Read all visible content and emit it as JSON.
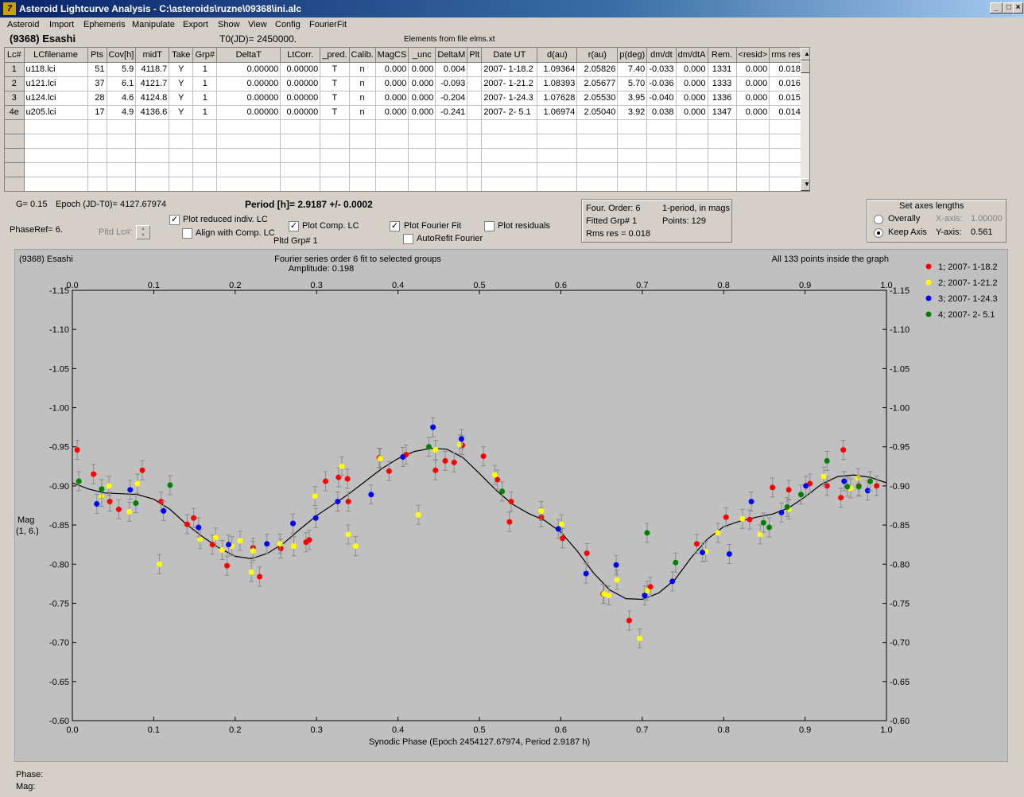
{
  "window": {
    "title": "Asteroid Lightcurve Analysis - C:\\asteroids\\ruzne\\09368\\ini.alc",
    "min_label": "_",
    "max_label": "□",
    "close_label": "×"
  },
  "menu": [
    "Asteroid",
    "Import",
    "Ephemeris",
    "Manipulate",
    "Export",
    "Show",
    "View",
    "Config",
    "FourierFit"
  ],
  "header": {
    "asteroid": "(9368) Esashi",
    "t0": "T0(JD)= 2450000.",
    "elements": "Elements from file elms.xt"
  },
  "grid": {
    "columns": [
      "Lc#",
      "LCfilename",
      "Pts",
      "Cov[h]",
      "midT",
      "Take",
      "Grp#",
      "DeltaT",
      "LtCorr.",
      "_pred.",
      "Calib.",
      "MagCS",
      "_unc",
      "DeltaM",
      "Plt",
      "Date UT",
      "d(au)",
      "r(au)",
      "p(deg)",
      "dm/dt",
      "dm/dtA",
      "Rem.",
      "<resid>",
      "rms res"
    ],
    "rows": [
      [
        "1",
        "u118.lci",
        "51",
        "5.9",
        "4118.7",
        "Y",
        "1",
        "0.00000",
        "0.00000",
        "T",
        "n",
        "0.000",
        "0.000",
        "0.004",
        "",
        "2007- 1-18.2",
        "1.09364",
        "2.05826",
        "7.40",
        "-0.033",
        "0.000",
        "1331",
        "0.000",
        "0.018"
      ],
      [
        "2",
        "u121.lci",
        "37",
        "6.1",
        "4121.7",
        "Y",
        "1",
        "0.00000",
        "0.00000",
        "T",
        "n",
        "0.000",
        "0.000",
        "-0.093",
        "",
        "2007- 1-21.2",
        "1.08393",
        "2.05677",
        "5.70",
        "-0.036",
        "0.000",
        "1333",
        "0.000",
        "0.016"
      ],
      [
        "3",
        "u124.lci",
        "28",
        "4.6",
        "4124.8",
        "Y",
        "1",
        "0.00000",
        "0.00000",
        "T",
        "n",
        "0.000",
        "0.000",
        "-0.204",
        "",
        "2007- 1-24.3",
        "1.07628",
        "2.05530",
        "3.95",
        "-0.040",
        "0.000",
        "1336",
        "0.000",
        "0.015"
      ],
      [
        "4e",
        "u205.lci",
        "17",
        "4.9",
        "4136.6",
        "Y",
        "1",
        "0.00000",
        "0.00000",
        "T",
        "n",
        "0.000",
        "0.000",
        "-0.241",
        "",
        "2007- 2- 5.1",
        "1.06974",
        "2.05040",
        "3.92",
        "0.038",
        "0.000",
        "1347",
        "0.000",
        "0.014"
      ]
    ],
    "empty_rows": 6,
    "scroll_up": "▲",
    "scroll_down": "▼"
  },
  "controls": {
    "g_label": "G= 0.15",
    "epoch_label": "Epoch (JD-T0)= 4127.67974",
    "period_label": "Period [h]= 2.9187 +/- 0.0002",
    "phaseref_label": "PhaseRef= 6.",
    "pltd_lc_label": "Pltd Lc#:",
    "pltd_grp_label": "Pltd Grp#  1",
    "plot_reduced": {
      "label": "Plot reduced indiv. LC",
      "checked": true
    },
    "align_comp": {
      "label": "Align with Comp. LC",
      "checked": false
    },
    "plot_comp": {
      "label": "Plot Comp. LC",
      "checked": true
    },
    "plot_fourier": {
      "label": "Plot Fourier Fit",
      "checked": true
    },
    "autorefit": {
      "label": "AutoRefit Fourier",
      "checked": false
    },
    "plot_residuals": {
      "label": "Plot residuals",
      "checked": false
    },
    "check_mark": "✓"
  },
  "fourier_box": {
    "order": "Four. Order:  6",
    "mode": "1-period, in mags",
    "fitted": "Fitted Grp# 1",
    "points": "Points: 129",
    "rms": "Rms res     = 0.018"
  },
  "axes_box": {
    "title": "Set axes lengths",
    "overally": "Overally",
    "keep_axis": "Keep Axis",
    "x_axis_label": "X-axis:",
    "x_axis_value": "1.00000",
    "y_axis_label": "Y-axis:",
    "y_axis_value": "0.561"
  },
  "chart_data": {
    "type": "scatter",
    "top_left_text": "(9368) Esashi",
    "title": "Fourier series order 6 fit to selected groups",
    "subtitle": "Amplitude: 0.198",
    "top_right_text": "All 133 points inside the graph",
    "xlabel": "Synodic Phase (Epoch 2454127.67974, Period 2.9187 h)",
    "ylabel": "Mag",
    "ylabel2": "(1, 6.)",
    "xlim": [
      0,
      1
    ],
    "ylim": [
      -1.15,
      -0.6
    ],
    "y_inverted": true,
    "x_ticks": [
      "0.0",
      "0.1",
      "0.2",
      "0.3",
      "0.4",
      "0.5",
      "0.6",
      "0.7",
      "0.8",
      "0.9",
      "1.0"
    ],
    "y_ticks": [
      "-1.15",
      "-1.10",
      "-1.05",
      "-1.00",
      "-0.95",
      "-0.90",
      "-0.85",
      "-0.80",
      "-0.75",
      "-0.70",
      "-0.65",
      "-0.60"
    ],
    "series": [
      {
        "name": "1; 2007- 1-18.2",
        "color": "#ff0000",
        "points": [
          [
            0.006,
            -0.946
          ],
          [
            0.026,
            -0.915
          ],
          [
            0.046,
            -0.88
          ],
          [
            0.057,
            -0.87
          ],
          [
            0.086,
            -0.92
          ],
          [
            0.109,
            -0.88
          ],
          [
            0.141,
            -0.851
          ],
          [
            0.149,
            -0.859
          ],
          [
            0.172,
            -0.825
          ],
          [
            0.19,
            -0.798
          ],
          [
            0.222,
            -0.821
          ],
          [
            0.23,
            -0.784
          ],
          [
            0.256,
            -0.82
          ],
          [
            0.287,
            -0.828
          ],
          [
            0.291,
            -0.831
          ],
          [
            0.311,
            -0.906
          ],
          [
            0.327,
            -0.911
          ],
          [
            0.338,
            -0.909
          ],
          [
            0.339,
            -0.88
          ],
          [
            0.377,
            -0.936
          ],
          [
            0.389,
            -0.919
          ],
          [
            0.41,
            -0.94
          ],
          [
            0.446,
            -0.92
          ],
          [
            0.458,
            -0.932
          ],
          [
            0.469,
            -0.93
          ],
          [
            0.479,
            -0.952
          ],
          [
            0.505,
            -0.938
          ],
          [
            0.522,
            -0.908
          ],
          [
            0.537,
            -0.854
          ],
          [
            0.539,
            -0.88
          ],
          [
            0.576,
            -0.86
          ],
          [
            0.602,
            -0.833
          ],
          [
            0.632,
            -0.814
          ],
          [
            0.652,
            -0.762
          ],
          [
            0.684,
            -0.728
          ],
          [
            0.71,
            -0.771
          ],
          [
            0.767,
            -0.826
          ],
          [
            0.803,
            -0.86
          ],
          [
            0.832,
            -0.857
          ],
          [
            0.86,
            -0.898
          ],
          [
            0.88,
            -0.895
          ],
          [
            0.906,
            -0.903
          ],
          [
            0.927,
            -0.9
          ],
          [
            0.944,
            -0.885
          ],
          [
            0.947,
            -0.946
          ],
          [
            0.966,
            -0.9
          ],
          [
            0.988,
            -0.9
          ]
        ]
      },
      {
        "name": "2; 2007- 1-21.2",
        "color": "#ffff00",
        "points": [
          [
            0.036,
            -0.886
          ],
          [
            0.045,
            -0.9
          ],
          [
            0.07,
            -0.867
          ],
          [
            0.08,
            -0.903
          ],
          [
            0.107,
            -0.8
          ],
          [
            0.157,
            -0.832
          ],
          [
            0.176,
            -0.834
          ],
          [
            0.184,
            -0.818
          ],
          [
            0.196,
            -0.823
          ],
          [
            0.206,
            -0.83
          ],
          [
            0.22,
            -0.79
          ],
          [
            0.222,
            -0.817
          ],
          [
            0.255,
            -0.826
          ],
          [
            0.272,
            -0.823
          ],
          [
            0.298,
            -0.887
          ],
          [
            0.331,
            -0.925
          ],
          [
            0.339,
            -0.838
          ],
          [
            0.348,
            -0.823
          ],
          [
            0.378,
            -0.935
          ],
          [
            0.425,
            -0.863
          ],
          [
            0.446,
            -0.946
          ],
          [
            0.476,
            -0.953
          ],
          [
            0.519,
            -0.914
          ],
          [
            0.576,
            -0.868
          ],
          [
            0.601,
            -0.851
          ],
          [
            0.653,
            -0.762
          ],
          [
            0.659,
            -0.76
          ],
          [
            0.669,
            -0.78
          ],
          [
            0.697,
            -0.705
          ],
          [
            0.706,
            -0.766
          ],
          [
            0.778,
            -0.816
          ],
          [
            0.793,
            -0.84
          ],
          [
            0.823,
            -0.858
          ],
          [
            0.845,
            -0.838
          ],
          [
            0.88,
            -0.87
          ],
          [
            0.923,
            -0.912
          ],
          [
            0.956,
            -0.897
          ],
          [
            0.965,
            -0.91
          ]
        ]
      },
      {
        "name": "3; 2007- 1-24.3",
        "color": "#0000ff",
        "points": [
          [
            0.03,
            -0.877
          ],
          [
            0.071,
            -0.895
          ],
          [
            0.112,
            -0.868
          ],
          [
            0.155,
            -0.847
          ],
          [
            0.192,
            -0.825
          ],
          [
            0.239,
            -0.826
          ],
          [
            0.271,
            -0.852
          ],
          [
            0.299,
            -0.859
          ],
          [
            0.326,
            -0.88
          ],
          [
            0.367,
            -0.889
          ],
          [
            0.406,
            -0.937
          ],
          [
            0.443,
            -0.975
          ],
          [
            0.478,
            -0.96
          ],
          [
            0.597,
            -0.845
          ],
          [
            0.631,
            -0.788
          ],
          [
            0.668,
            -0.799
          ],
          [
            0.703,
            -0.76
          ],
          [
            0.737,
            -0.778
          ],
          [
            0.774,
            -0.815
          ],
          [
            0.807,
            -0.813
          ],
          [
            0.834,
            -0.88
          ],
          [
            0.871,
            -0.866
          ],
          [
            0.901,
            -0.9
          ],
          [
            0.948,
            -0.906
          ],
          [
            0.977,
            -0.894
          ]
        ]
      },
      {
        "name": "4; 2007- 2- 5.1",
        "color": "#008000",
        "points": [
          [
            0.008,
            -0.906
          ],
          [
            0.036,
            -0.896
          ],
          [
            0.078,
            -0.878
          ],
          [
            0.12,
            -0.901
          ],
          [
            0.438,
            -0.95
          ],
          [
            0.528,
            -0.893
          ],
          [
            0.706,
            -0.84
          ],
          [
            0.741,
            -0.802
          ],
          [
            0.849,
            -0.853
          ],
          [
            0.856,
            -0.847
          ],
          [
            0.878,
            -0.873
          ],
          [
            0.895,
            -0.889
          ],
          [
            0.927,
            -0.932
          ],
          [
            0.952,
            -0.899
          ],
          [
            0.966,
            -0.899
          ],
          [
            0.98,
            -0.906
          ]
        ]
      }
    ],
    "fit_curve": [
      [
        0.0,
        -0.904
      ],
      [
        0.02,
        -0.896
      ],
      [
        0.04,
        -0.891
      ],
      [
        0.06,
        -0.89
      ],
      [
        0.08,
        -0.889
      ],
      [
        0.1,
        -0.883
      ],
      [
        0.12,
        -0.87
      ],
      [
        0.14,
        -0.851
      ],
      [
        0.16,
        -0.835
      ],
      [
        0.18,
        -0.821
      ],
      [
        0.2,
        -0.81
      ],
      [
        0.22,
        -0.807
      ],
      [
        0.24,
        -0.814
      ],
      [
        0.26,
        -0.827
      ],
      [
        0.28,
        -0.845
      ],
      [
        0.3,
        -0.862
      ],
      [
        0.32,
        -0.876
      ],
      [
        0.34,
        -0.89
      ],
      [
        0.36,
        -0.906
      ],
      [
        0.38,
        -0.922
      ],
      [
        0.4,
        -0.935
      ],
      [
        0.42,
        -0.944
      ],
      [
        0.44,
        -0.948
      ],
      [
        0.46,
        -0.947
      ],
      [
        0.48,
        -0.936
      ],
      [
        0.5,
        -0.916
      ],
      [
        0.52,
        -0.895
      ],
      [
        0.54,
        -0.877
      ],
      [
        0.56,
        -0.865
      ],
      [
        0.58,
        -0.856
      ],
      [
        0.6,
        -0.841
      ],
      [
        0.62,
        -0.817
      ],
      [
        0.64,
        -0.789
      ],
      [
        0.66,
        -0.767
      ],
      [
        0.68,
        -0.756
      ],
      [
        0.7,
        -0.755
      ],
      [
        0.72,
        -0.763
      ],
      [
        0.74,
        -0.78
      ],
      [
        0.76,
        -0.808
      ],
      [
        0.78,
        -0.832
      ],
      [
        0.8,
        -0.848
      ],
      [
        0.82,
        -0.855
      ],
      [
        0.84,
        -0.86
      ],
      [
        0.86,
        -0.864
      ],
      [
        0.88,
        -0.872
      ],
      [
        0.9,
        -0.886
      ],
      [
        0.92,
        -0.902
      ],
      [
        0.94,
        -0.912
      ],
      [
        0.96,
        -0.914
      ],
      [
        0.98,
        -0.911
      ],
      [
        1.0,
        -0.904
      ]
    ]
  },
  "status": {
    "phase_label": "Phase:",
    "mag_label": "Mag:"
  }
}
